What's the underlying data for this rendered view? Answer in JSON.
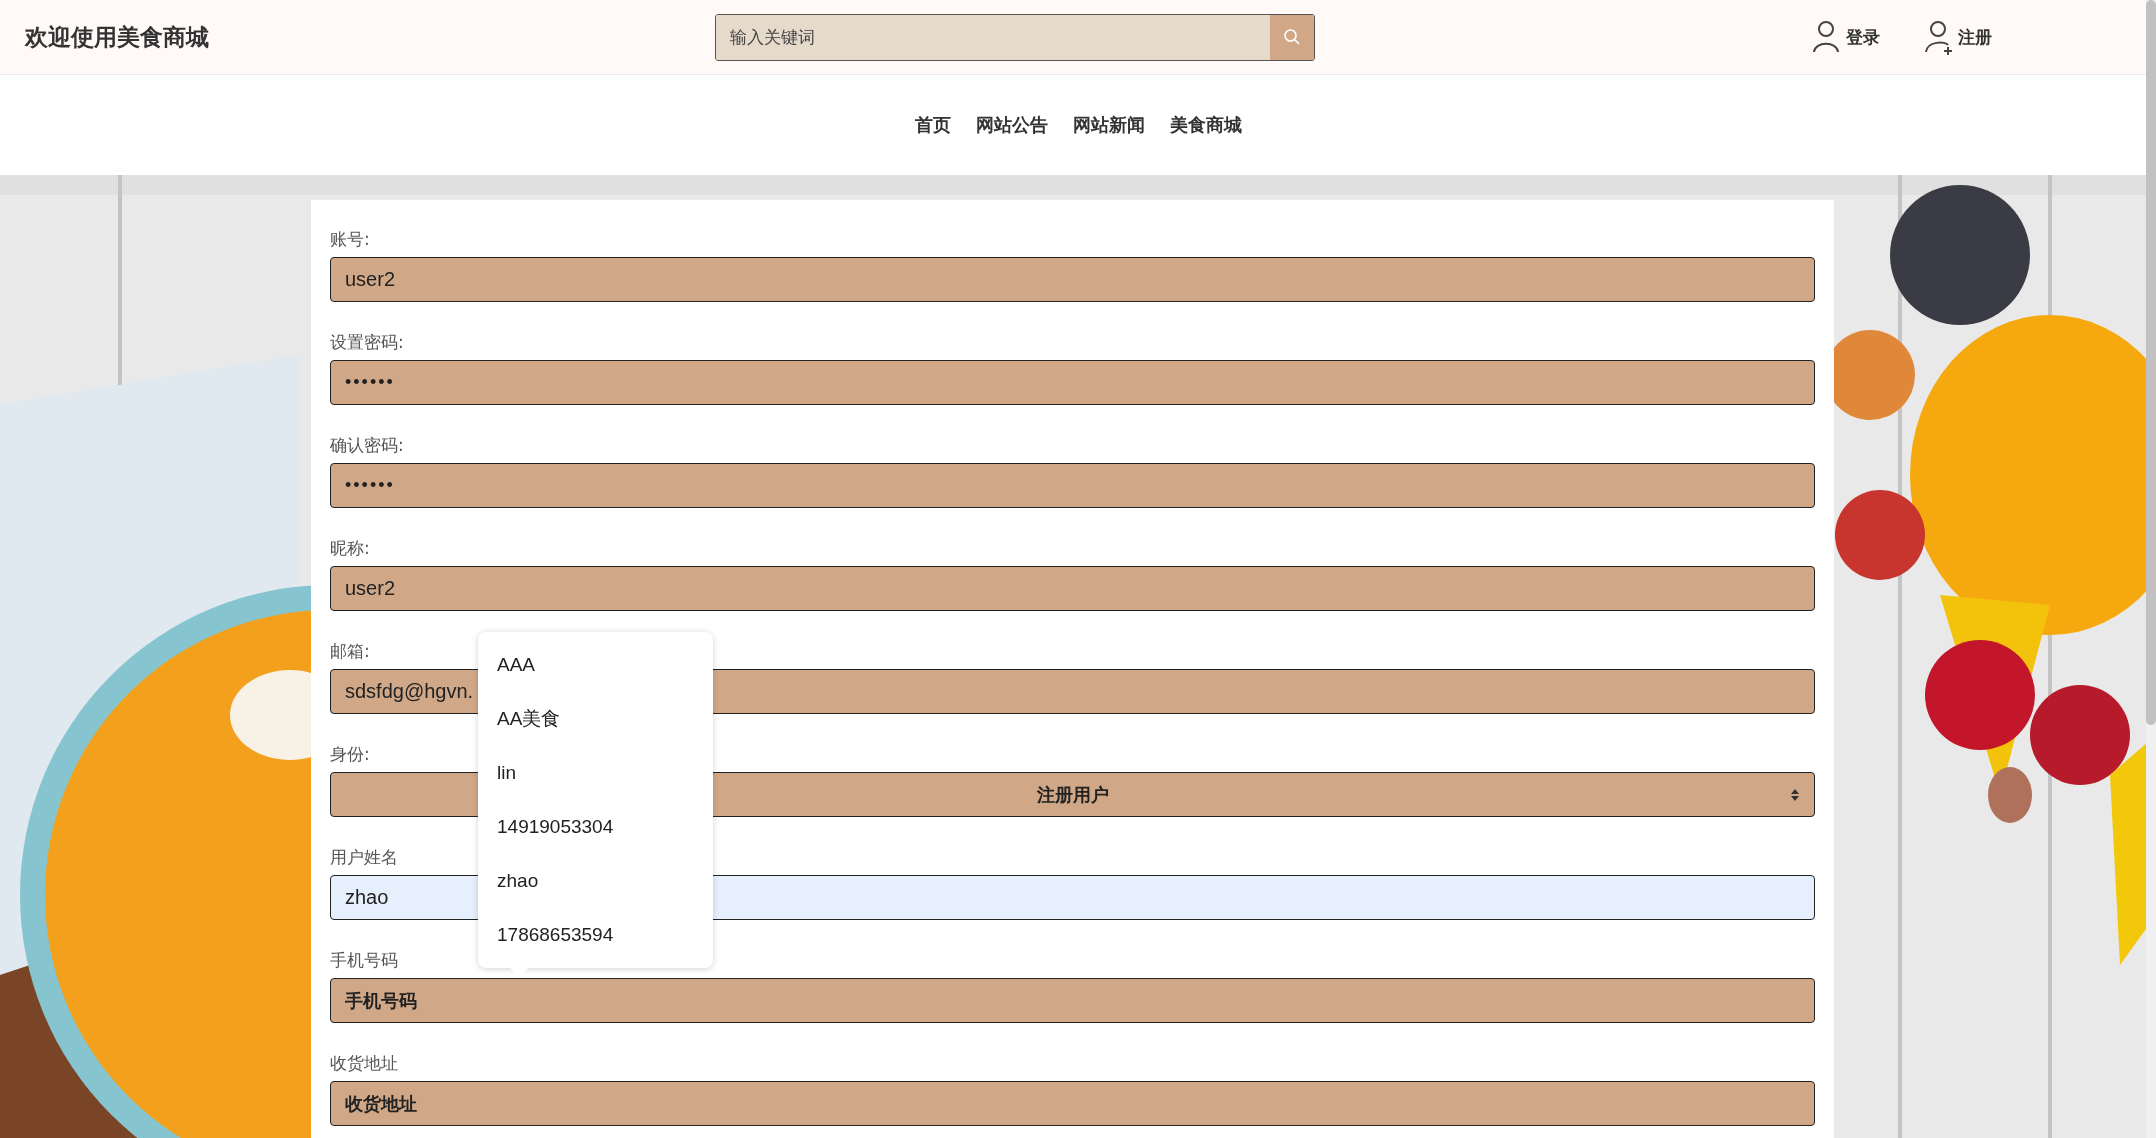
{
  "header": {
    "title": "欢迎使用美食商城",
    "search": {
      "placeholder": "输入关键词"
    },
    "links": [
      {
        "label": "登录",
        "kind": "login"
      },
      {
        "label": "注册",
        "kind": "register"
      }
    ]
  },
  "nav": [
    {
      "label": "首页"
    },
    {
      "label": "网站公告"
    },
    {
      "label": "网站新闻"
    },
    {
      "label": "美食商城"
    }
  ],
  "form": {
    "fields": [
      {
        "label": "账号:",
        "kind": "text",
        "value": "user2",
        "autofilled": false
      },
      {
        "label": "设置密码:",
        "kind": "password",
        "value": "••••••",
        "autofilled": false
      },
      {
        "label": "确认密码:",
        "kind": "password",
        "value": "••••••",
        "autofilled": false
      },
      {
        "label": "昵称:",
        "kind": "text",
        "value": "user2",
        "autofilled": false
      },
      {
        "label": "邮箱:",
        "kind": "text",
        "value": "sdsfdg@hgvn.",
        "autofilled": false
      },
      {
        "label": "身份:",
        "kind": "select",
        "value": "注册用户",
        "autofilled": false
      },
      {
        "label": "用户姓名",
        "kind": "text",
        "value": "zhao",
        "autofilled": true
      },
      {
        "label": "手机号码",
        "kind": "text",
        "placeholder": "手机号码",
        "autofilled": false
      },
      {
        "label": "收货地址",
        "kind": "text",
        "placeholder": "收货地址",
        "autofilled": false
      }
    ]
  },
  "suggestions": {
    "items": [
      "AAA",
      "AA美食",
      "lin",
      "14919053304",
      "zhao",
      "17868653594"
    ]
  }
}
